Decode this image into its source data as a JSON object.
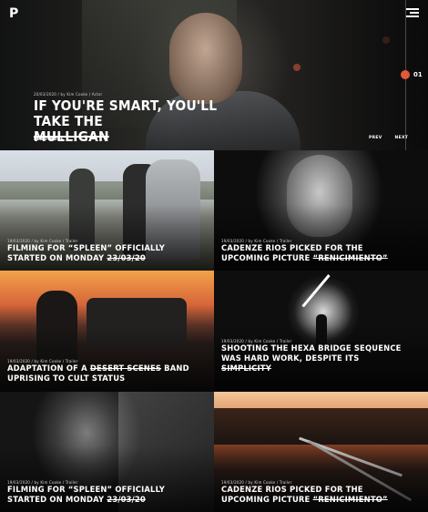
{
  "header": {
    "logo": "P",
    "slide_number": "01"
  },
  "hero": {
    "meta": "20/03/2020 / by Kim Cooke / Actor",
    "title_part1": "IF YOU'RE SMART, YOU'LL TAKE THE",
    "title_strike": "MULLIGAN",
    "read_more": "READ MORE",
    "prev": "PREV",
    "next": "NEXT"
  },
  "cards": [
    {
      "meta": "19/03/2020 / by Kim Cooke / Trailer",
      "title_before": "FILMING FOR “SPLEEN” OFFICIALLY STARTED ON MONDAY ",
      "title_strike": "23/03/20",
      "title_after": ""
    },
    {
      "meta": "19/03/2020 / by Kim Cooke / Trailer",
      "title_before": "CADENZE RIOS PICKED FOR THE UPCOMING PICTURE ",
      "title_strike": "“RENICIMIENTO”",
      "title_after": ""
    },
    {
      "meta": "19/03/2020 / by Kim Cooke / Trailer",
      "title_before": "ADAPTATION OF A ",
      "title_strike": "DESERT SCENES",
      "title_after": " BAND UPRISING TO CULT STATUS"
    },
    {
      "meta": "19/03/2020 / by Kim Cooke / Trailer",
      "title_before": "SHOOTING THE HEXA BRIDGE SEQUENCE WAS HARD WORK, DESPITE ITS ",
      "title_strike": "SIMPLICITY",
      "title_after": ""
    },
    {
      "meta": "19/03/2020 / by Kim Cooke / Trailer",
      "title_before": "FILMING FOR “SPLEEN” OFFICIALLY STARTED ON MONDAY ",
      "title_strike": "23/03/20",
      "title_after": ""
    },
    {
      "meta": "19/03/2020 / by Kim Cooke / Trailer",
      "title_before": "CADENZE RIOS PICKED FOR THE UPCOMING PICTURE ",
      "title_strike": "“RENICIMIENTO”",
      "title_after": ""
    }
  ],
  "colors": {
    "accent": "#e2583a",
    "background": "#111111",
    "text": "#ffffff"
  },
  "icons": {
    "menu": "hamburger-menu-icon",
    "slide_indicator": "dot-icon"
  }
}
